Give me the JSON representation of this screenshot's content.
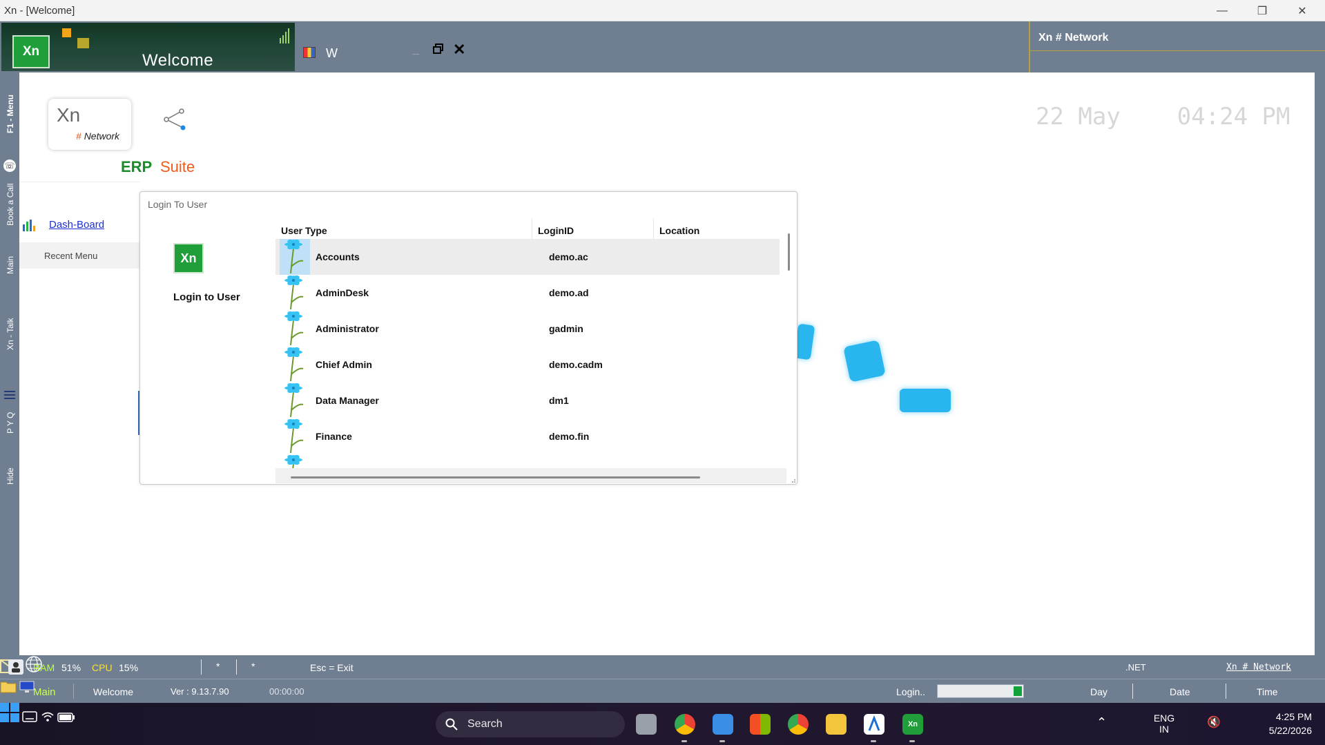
{
  "window": {
    "title": "Xn - [Welcome]",
    "minimize": "—",
    "restore": "❐",
    "close": "✕"
  },
  "header": {
    "logo_text": "Xn",
    "welcome_title": "Welcome",
    "tab_label": "W",
    "brand": "Xn # Network"
  },
  "left_strip": {
    "items": [
      "F1 - Menu",
      "Book a Call",
      "Main",
      "Xn - Talk",
      "P Y Q",
      "Hide"
    ]
  },
  "main": {
    "card_logo": "Xn",
    "card_hash": "#",
    "card_network": "Network",
    "erp": "ERP",
    "suite": "Suite",
    "date": "22 May",
    "time": "04:24 PM",
    "dashboard_link": "Dash-Board",
    "recent_menu": "Recent Menu"
  },
  "dialog": {
    "title": "Login To User",
    "logo_text": "Xn",
    "side_label": "Login to User",
    "columns": [
      "User Type",
      "LoginID",
      "Location"
    ],
    "rows": [
      {
        "user_type": "Accounts",
        "login_id": "demo.ac",
        "location": "",
        "selected": true
      },
      {
        "user_type": "AdminDesk",
        "login_id": "demo.ad",
        "location": "",
        "selected": false
      },
      {
        "user_type": "Administrator",
        "login_id": "gadmin",
        "location": "",
        "selected": false
      },
      {
        "user_type": "Chief Admin",
        "login_id": "demo.cadm",
        "location": "",
        "selected": false
      },
      {
        "user_type": "Data Manager",
        "login_id": "dm1",
        "location": "",
        "selected": false
      },
      {
        "user_type": "Finance",
        "login_id": "demo.fin",
        "location": "",
        "selected": false
      }
    ]
  },
  "status1": {
    "ram_label": "RAM",
    "ram_value": "51%",
    "cpu_label": "CPU",
    "cpu_value": "15%",
    "star1": "*",
    "star2": "*",
    "esc": "Esc = Exit",
    "dotnet": ".NET",
    "network_link": "Xn # Network"
  },
  "status2": {
    "main": "Main",
    "welcome": "Welcome",
    "version": "Ver : 9.13.7.90",
    "elapsed": "00:00:00",
    "login": "Login..",
    "day": "Day",
    "date": "Date",
    "time": "Time"
  },
  "taskbar": {
    "search": "Search",
    "lang_top": "ENG",
    "lang_bottom": "IN",
    "clock_time": "4:25 PM",
    "clock_date": "5/22/2026"
  },
  "colors": {
    "chrome": "#6f7f91",
    "accent_green": "#1f9e3a",
    "erp_green": "#1b8c2a",
    "suite_orange": "#f05a1a",
    "cyan": "#29b6ee"
  }
}
